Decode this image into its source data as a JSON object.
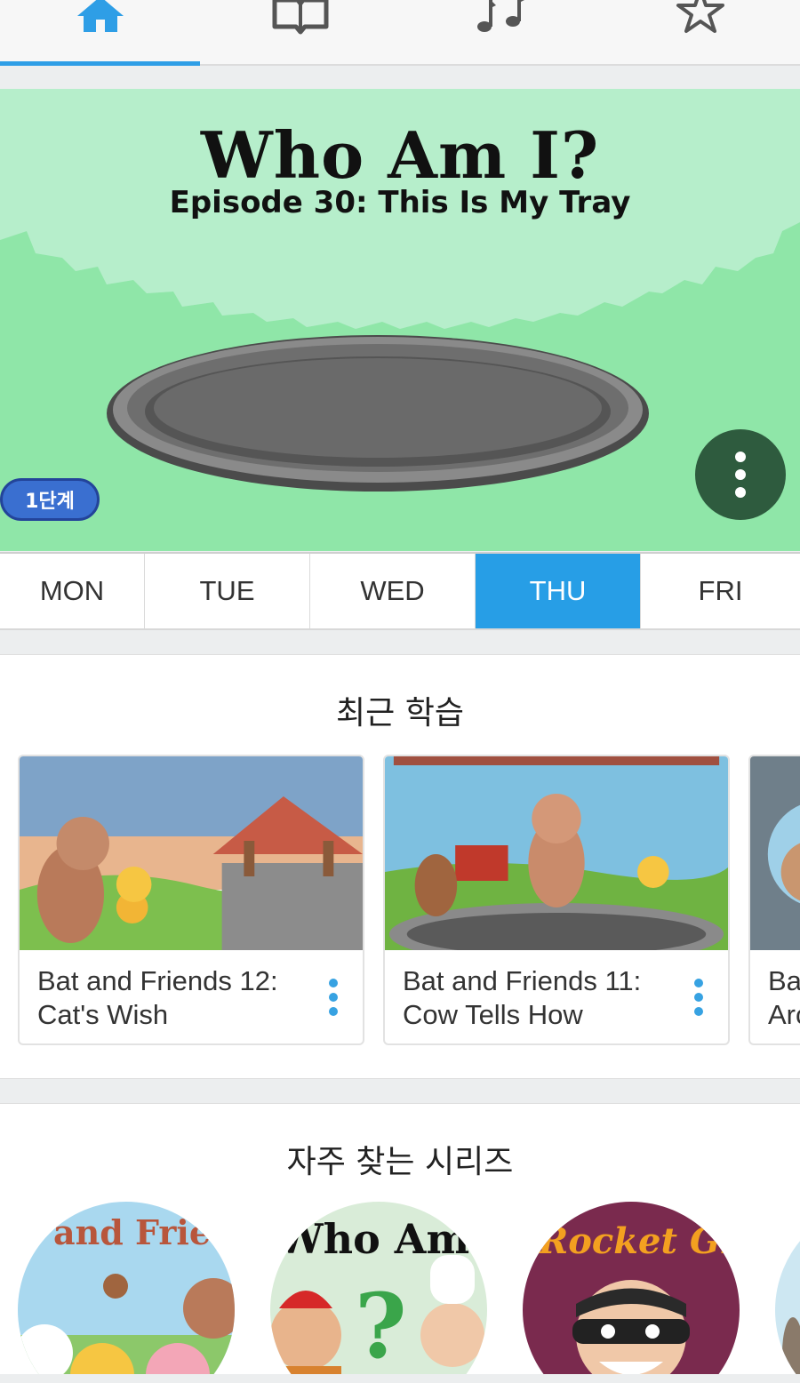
{
  "nav": {
    "tabs": [
      {
        "icon": "home-icon",
        "active": true
      },
      {
        "icon": "book-icon",
        "active": false
      },
      {
        "icon": "music-note-icon",
        "active": false
      },
      {
        "icon": "star-icon",
        "active": false
      }
    ]
  },
  "hero": {
    "title": "Who Am I?",
    "subtitle": "Episode 30: This Is My Tray",
    "level": "1단계"
  },
  "days": [
    "MON",
    "TUE",
    "WED",
    "THU",
    "FRI"
  ],
  "selected_day": "THU",
  "recent": {
    "title": "최근 학습",
    "cards": [
      {
        "title_line1": "Bat and Friends 12:",
        "title_line2": "Cat's Wish"
      },
      {
        "title_line1": "Bat and Friends 11:",
        "title_line2": "Cow Tells How"
      },
      {
        "title_line1": "Ba",
        "title_line2": "Arc"
      }
    ]
  },
  "series": {
    "title": "자주 찾는 시리즈",
    "items": [
      {
        "logo_text": "and Frie"
      },
      {
        "logo_text": "Who Am I"
      },
      {
        "logo_text": "Rocket Gi"
      }
    ]
  },
  "colors": {
    "accent": "#279ee6",
    "hero_bg": "#9ce8b5",
    "more_button": "#2e5b3e",
    "badge": "#3a6fd0"
  }
}
